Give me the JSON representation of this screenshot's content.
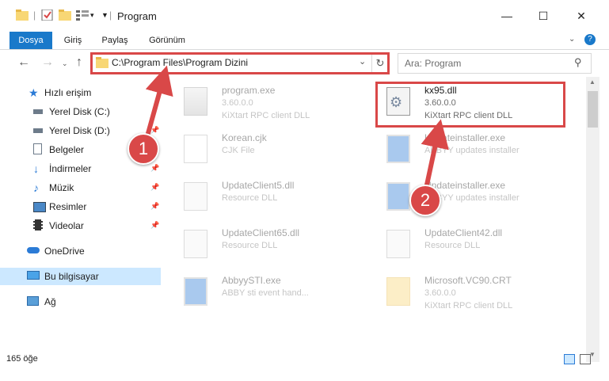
{
  "window": {
    "title": "Program",
    "controls": {
      "minimize": "—",
      "maximize": "☐",
      "close": "✕"
    }
  },
  "ribbon": {
    "tabs": [
      "Dosya",
      "Giriş",
      "Paylaş",
      "Görünüm"
    ],
    "help_icon": "?"
  },
  "address": {
    "path": "C:\\Program Files\\Program Dizini",
    "search_placeholder": "Ara: Program"
  },
  "sidebar": {
    "items": [
      {
        "label": "Hızlı erişim",
        "icon": "star-icon"
      },
      {
        "label": "Yerel Disk (C:)",
        "icon": "drive-icon"
      },
      {
        "label": "Yerel Disk (D:)",
        "icon": "drive-icon"
      },
      {
        "label": "Belgeler",
        "icon": "document-icon"
      },
      {
        "label": "İndirmeler",
        "icon": "download-icon"
      },
      {
        "label": "Müzik",
        "icon": "music-icon"
      },
      {
        "label": "Resimler",
        "icon": "pictures-icon"
      },
      {
        "label": "Videolar",
        "icon": "video-icon"
      },
      {
        "label": "OneDrive",
        "icon": "cloud-icon"
      },
      {
        "label": "Bu bilgisayar",
        "icon": "computer-icon"
      },
      {
        "label": "Ağ",
        "icon": "network-icon"
      }
    ]
  },
  "files": [
    {
      "name": "program.exe",
      "line2": "3.60.0.0",
      "line3": "KiXtart RPC client DLL"
    },
    {
      "name": "kx95.dll",
      "line2": "3.60.0.0",
      "line3": "KiXtart RPC client DLL"
    },
    {
      "name": "Korean.cjk",
      "line2": "CJK File",
      "line3": ""
    },
    {
      "name": "Updateinstaller.exe",
      "line2": "ABBYY updates installer",
      "line3": ""
    },
    {
      "name": "UpdateClient5.dll",
      "line2": "Resource DLL",
      "line3": ""
    },
    {
      "name": "Updateinstaller.exe",
      "line2": "ABBYY updates installer",
      "line3": ""
    },
    {
      "name": "UpdateClient65.dll",
      "line2": "Resource DLL",
      "line3": ""
    },
    {
      "name": "UpdateClient42.dll",
      "line2": "Resource DLL",
      "line3": ""
    },
    {
      "name": "AbbyySTI.exe",
      "line2": "ABBY sti event hand...",
      "line3": ""
    },
    {
      "name": "Microsoft.VC90.CRT",
      "line2": "3.60.0.0",
      "line3": "KiXtart RPC client DLL"
    }
  ],
  "status": {
    "item_count": "165 öğe"
  },
  "annotations": {
    "step1": "1",
    "step2": "2"
  },
  "colors": {
    "accent": "#1979ca",
    "highlight": "#d94848",
    "selected": "#cce8ff"
  }
}
